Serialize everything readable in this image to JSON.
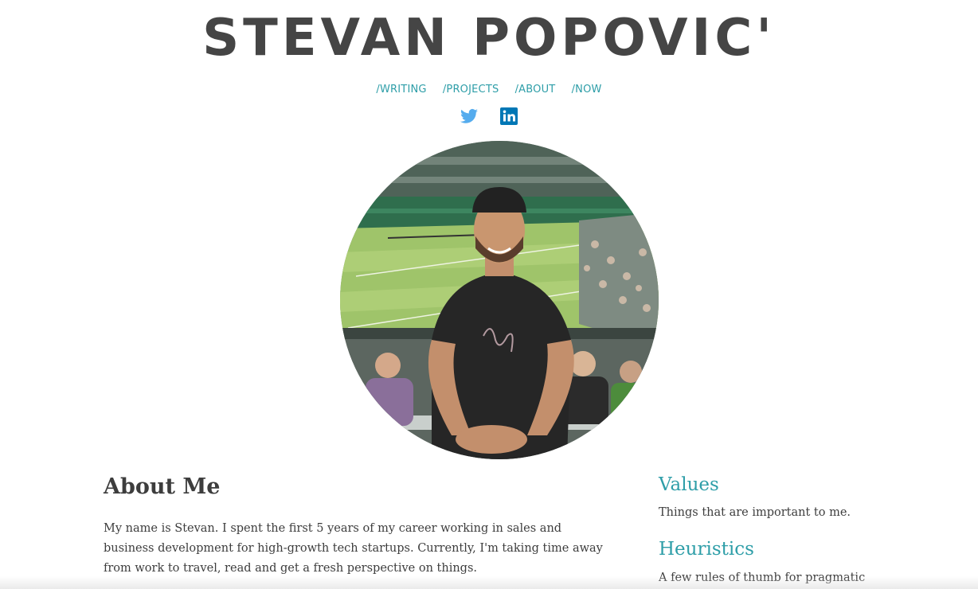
{
  "header": {
    "title": "STEVAN POPOVIC'"
  },
  "nav": {
    "items": [
      {
        "label": "/WRITING"
      },
      {
        "label": "/PROJECTS"
      },
      {
        "label": "/ABOUT"
      },
      {
        "label": "/NOW"
      }
    ]
  },
  "social": {
    "icons": [
      "twitter-icon",
      "linkedin-icon"
    ],
    "twitter_color": "#55acee",
    "linkedin_color": "#0077b5"
  },
  "photo": {
    "alt": "Stevan at a tennis match"
  },
  "about": {
    "title": "About Me",
    "text": "My name is Stevan. I spent the first 5 years of my career working in sales and business development for high-growth tech startups. Currently, I'm taking time away from work to travel, read and get a fresh perspective on things."
  },
  "sidebar": {
    "values": {
      "heading": "Values",
      "text": "Things that are important to me."
    },
    "heuristics": {
      "heading": "Heuristics",
      "text": "A few rules of thumb for pragmatic"
    }
  },
  "colors": {
    "accent": "#2e9ea8",
    "title": "#454545",
    "body_text": "#3d3d3d"
  }
}
